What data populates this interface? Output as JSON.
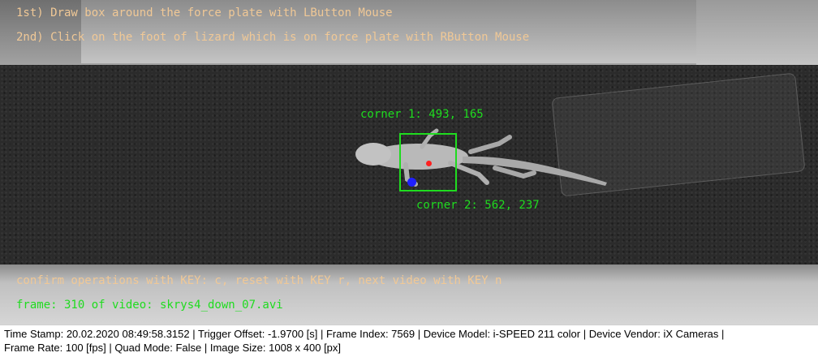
{
  "instructions": {
    "line1": "1st) Draw box around the force plate with LButton Mouse",
    "line2": "2nd) Click on the foot of lizard which is on force plate with RButton Mouse",
    "color": "#f0c896"
  },
  "corners": {
    "corner1_label": "corner 1: 493, 165",
    "corner2_label": "corner 2: 562, 237",
    "color": "#1fdc1f"
  },
  "markers": {
    "red_dot_color": "#ff2020",
    "blue_dot_color": "#2020ff"
  },
  "footer_overlay": {
    "confirm_text": "confirm operations with KEY: c, reset with KEY r, next video with KEY n",
    "frame_text": "frame: 310 of video: skrys4_down_07.avi",
    "confirm_color": "#f0c896",
    "frame_color": "#1fdc1f"
  },
  "status_bar": {
    "line1": "Time Stamp: 20.02.2020 08:49:58.3152  |  Trigger Offset: -1.9700 [s]  |  Frame Index: 7569  |  Device Model: i-SPEED 211 color  |  Device Vendor: iX Cameras  |",
    "line2": "Frame Rate: 100 [fps]  |  Quad Mode: False  |  Image Size: 1008 x 400 [px]"
  }
}
